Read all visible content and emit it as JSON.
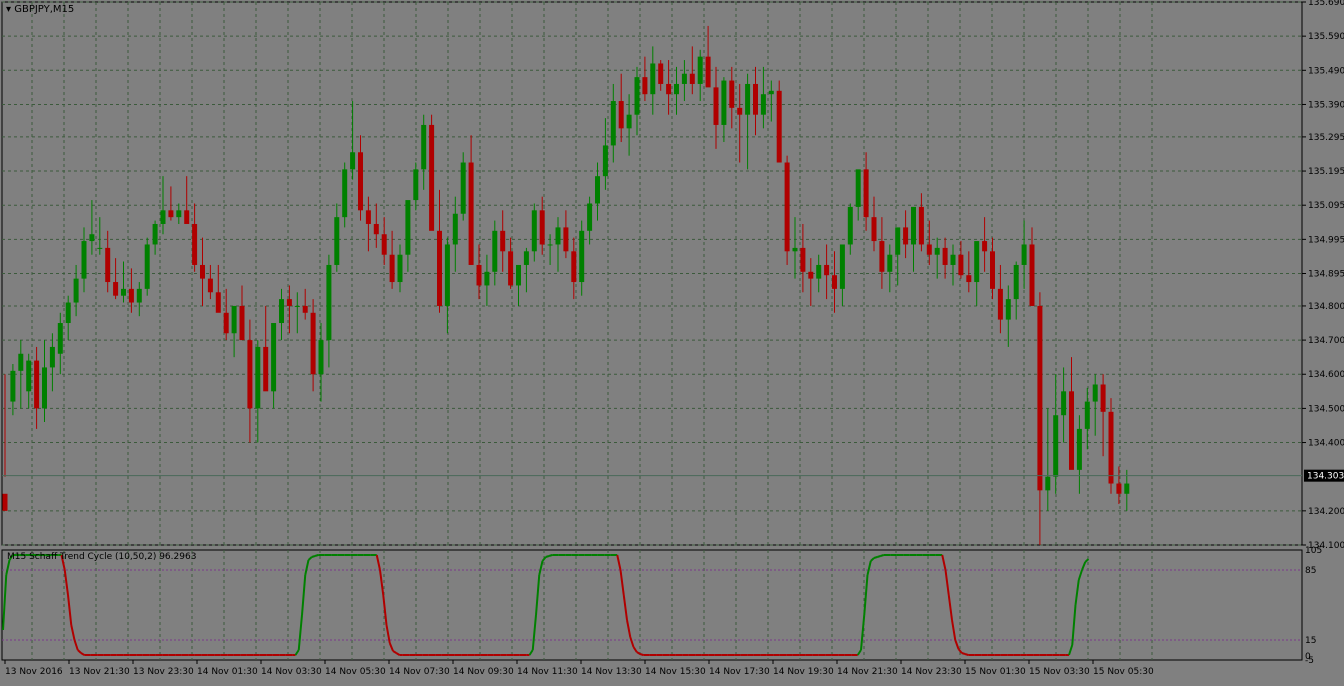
{
  "chart": {
    "symbol_label": "GBPJPY,M15",
    "indicator_label": "M15 Schaff Trend Cycle (10,50,2) 96.2963",
    "current_price": "134.303",
    "price_ticks": [
      "135.690",
      "135.590",
      "135.490",
      "135.390",
      "135.295",
      "135.195",
      "135.095",
      "134.995",
      "134.895",
      "134.800",
      "134.700",
      "134.600",
      "134.500",
      "134.400",
      "134.200",
      "134.100"
    ],
    "indicator_ticks": [
      "105",
      "85",
      "15",
      "-5",
      "0"
    ],
    "time_ticks": [
      "13 Nov 2016",
      "13 Nov 21:30",
      "13 Nov 23:30",
      "14 Nov 01:30",
      "14 Nov 03:30",
      "14 Nov 05:30",
      "14 Nov 07:30",
      "14 Nov 09:30",
      "14 Nov 11:30",
      "14 Nov 13:30",
      "14 Nov 15:30",
      "14 Nov 17:30",
      "14 Nov 19:30",
      "14 Nov 21:30",
      "14 Nov 23:30",
      "15 Nov 01:30",
      "15 Nov 03:30",
      "15 Nov 05:30"
    ],
    "colors": {
      "background": "#808080",
      "bull": "#008000",
      "bear": "#b00000",
      "grid": "#3c5a3c",
      "level": "#7a3a8a"
    }
  },
  "chart_data": [
    {
      "type": "candlestick",
      "title": "GBPJPY,M15",
      "ylim": [
        134.1,
        135.69
      ],
      "current_price": 134.303,
      "candles": [
        [
          134.25,
          134.6,
          134.3,
          134.2
        ],
        [
          134.52,
          134.63,
          134.48,
          134.61
        ],
        [
          134.61,
          134.7,
          134.5,
          134.66
        ],
        [
          134.55,
          134.66,
          134.5,
          134.64
        ],
        [
          134.64,
          134.68,
          134.44,
          134.5
        ],
        [
          134.5,
          134.7,
          134.46,
          134.62
        ],
        [
          134.62,
          134.72,
          134.55,
          134.68
        ],
        [
          134.66,
          134.78,
          134.6,
          134.75
        ],
        [
          134.75,
          134.83,
          134.7,
          134.81
        ],
        [
          134.81,
          134.92,
          134.77,
          134.88
        ],
        [
          134.88,
          135.03,
          134.84,
          134.99
        ],
        [
          134.99,
          135.11,
          134.95,
          135.01
        ],
        [
          134.97,
          135.06,
          134.95,
          134.97
        ],
        [
          134.97,
          135.02,
          134.84,
          134.87
        ],
        [
          134.87,
          134.94,
          134.82,
          134.83
        ],
        [
          134.83,
          134.93,
          134.81,
          134.85
        ],
        [
          134.85,
          134.91,
          134.78,
          134.81
        ],
        [
          134.81,
          134.87,
          134.77,
          134.85
        ],
        [
          134.85,
          135.0,
          134.83,
          134.98
        ],
        [
          134.98,
          135.05,
          134.95,
          135.04
        ],
        [
          135.04,
          135.18,
          135.01,
          135.08
        ],
        [
          135.08,
          135.15,
          135.05,
          135.06
        ],
        [
          135.06,
          135.1,
          135.04,
          135.08
        ],
        [
          135.08,
          135.18,
          135.06,
          135.04
        ],
        [
          135.04,
          135.1,
          134.9,
          134.92
        ],
        [
          134.92,
          135.0,
          134.8,
          134.88
        ],
        [
          134.88,
          134.92,
          134.82,
          134.84
        ],
        [
          134.84,
          134.92,
          134.79,
          134.78
        ],
        [
          134.78,
          134.85,
          134.7,
          134.72
        ],
        [
          134.72,
          134.8,
          134.65,
          134.8
        ],
        [
          134.8,
          134.86,
          134.72,
          134.7
        ],
        [
          134.7,
          134.76,
          134.4,
          134.5
        ],
        [
          134.5,
          134.7,
          134.4,
          134.68
        ],
        [
          134.68,
          134.8,
          134.6,
          134.55
        ],
        [
          134.55,
          134.7,
          134.5,
          134.75
        ],
        [
          134.75,
          134.85,
          134.7,
          134.82
        ],
        [
          134.82,
          134.86,
          134.72,
          134.8
        ],
        [
          134.8,
          134.84,
          134.72,
          134.8
        ],
        [
          134.8,
          134.85,
          134.76,
          134.78
        ],
        [
          134.78,
          134.82,
          134.55,
          134.6
        ],
        [
          134.6,
          134.75,
          134.52,
          134.7
        ],
        [
          134.7,
          134.95,
          134.62,
          134.92
        ],
        [
          134.92,
          135.1,
          134.9,
          135.06
        ],
        [
          135.06,
          135.22,
          135.03,
          135.2
        ],
        [
          135.2,
          135.4,
          135.17,
          135.25
        ],
        [
          135.25,
          135.3,
          135.05,
          135.08
        ],
        [
          135.08,
          135.12,
          134.96,
          135.04
        ],
        [
          135.04,
          135.1,
          134.97,
          135.01
        ],
        [
          135.01,
          135.06,
          134.92,
          134.95
        ],
        [
          134.95,
          135.02,
          134.85,
          134.87
        ],
        [
          134.87,
          134.98,
          134.84,
          134.95
        ],
        [
          134.95,
          135.1,
          134.9,
          135.11
        ],
        [
          135.11,
          135.22,
          135.08,
          135.2
        ],
        [
          135.2,
          135.36,
          135.14,
          135.33
        ],
        [
          135.33,
          135.36,
          135.05,
          135.02
        ],
        [
          135.02,
          135.14,
          134.78,
          134.8
        ],
        [
          134.8,
          135.0,
          134.72,
          134.98
        ],
        [
          134.98,
          135.12,
          134.9,
          135.07
        ],
        [
          135.07,
          135.25,
          135.05,
          135.22
        ],
        [
          135.22,
          135.3,
          134.92,
          134.92
        ],
        [
          134.92,
          134.98,
          134.82,
          134.86
        ],
        [
          134.86,
          134.95,
          134.8,
          134.9
        ],
        [
          134.9,
          135.05,
          134.86,
          135.02
        ],
        [
          135.02,
          135.08,
          134.9,
          134.96
        ],
        [
          134.96,
          135.0,
          134.85,
          134.86
        ],
        [
          134.86,
          134.92,
          134.8,
          134.92
        ],
        [
          134.92,
          134.97,
          134.84,
          134.96
        ],
        [
          134.96,
          135.1,
          134.93,
          135.08
        ],
        [
          135.08,
          135.12,
          134.95,
          134.98
        ],
        [
          134.98,
          135.01,
          134.92,
          134.98
        ],
        [
          134.98,
          135.06,
          134.9,
          135.03
        ],
        [
          135.03,
          135.08,
          134.94,
          134.96
        ],
        [
          134.96,
          135.0,
          134.82,
          134.87
        ],
        [
          134.87,
          135.05,
          134.83,
          135.02
        ],
        [
          135.02,
          135.12,
          134.98,
          135.1
        ],
        [
          135.1,
          135.22,
          135.05,
          135.18
        ],
        [
          135.18,
          135.35,
          135.14,
          135.27
        ],
        [
          135.27,
          135.45,
          135.22,
          135.4
        ],
        [
          135.4,
          135.48,
          135.28,
          135.32
        ],
        [
          135.32,
          135.42,
          135.24,
          135.36
        ],
        [
          135.36,
          135.5,
          135.3,
          135.47
        ],
        [
          135.47,
          135.53,
          135.4,
          135.42
        ],
        [
          135.42,
          135.56,
          135.36,
          135.51
        ],
        [
          135.51,
          135.52,
          135.43,
          135.45
        ],
        [
          135.45,
          135.52,
          135.36,
          135.42
        ],
        [
          135.42,
          135.5,
          135.36,
          135.45
        ],
        [
          135.45,
          135.52,
          135.4,
          135.48
        ],
        [
          135.48,
          135.56,
          135.42,
          135.45
        ],
        [
          135.45,
          135.55,
          135.4,
          135.53
        ],
        [
          135.53,
          135.62,
          135.45,
          135.44
        ],
        [
          135.44,
          135.5,
          135.26,
          135.33
        ],
        [
          135.33,
          135.47,
          135.28,
          135.46
        ],
        [
          135.46,
          135.5,
          135.32,
          135.38
        ],
        [
          135.38,
          135.45,
          135.22,
          135.36
        ],
        [
          135.36,
          135.48,
          135.2,
          135.45
        ],
        [
          135.45,
          135.5,
          135.3,
          135.36
        ],
        [
          135.36,
          135.5,
          135.32,
          135.42
        ],
        [
          135.42,
          135.46,
          135.34,
          135.43
        ],
        [
          135.43,
          135.46,
          135.28,
          135.22
        ],
        [
          135.22,
          135.24,
          134.92,
          134.96
        ],
        [
          134.96,
          135.06,
          134.88,
          134.97
        ],
        [
          134.97,
          135.04,
          134.84,
          134.9
        ],
        [
          134.9,
          134.94,
          134.8,
          134.88
        ],
        [
          134.88,
          134.95,
          134.84,
          134.92
        ],
        [
          134.92,
          134.98,
          134.82,
          134.89
        ],
        [
          134.89,
          134.96,
          134.78,
          134.85
        ],
        [
          134.85,
          134.94,
          134.8,
          134.98
        ],
        [
          134.98,
          135.1,
          134.95,
          135.09
        ],
        [
          135.09,
          135.18,
          135.05,
          135.2
        ],
        [
          135.2,
          135.25,
          135.02,
          135.06
        ],
        [
          135.06,
          135.12,
          134.96,
          134.99
        ],
        [
          134.99,
          135.06,
          134.85,
          134.9
        ],
        [
          134.9,
          134.98,
          134.84,
          134.95
        ],
        [
          134.95,
          135.02,
          134.86,
          135.03
        ],
        [
          135.03,
          135.08,
          134.94,
          134.98
        ],
        [
          134.98,
          135.04,
          134.9,
          135.09
        ],
        [
          135.09,
          135.13,
          134.96,
          134.98
        ],
        [
          134.98,
          135.05,
          134.92,
          134.95
        ],
        [
          134.95,
          135.0,
          134.88,
          134.97
        ],
        [
          134.97,
          135.0,
          134.88,
          134.92
        ],
        [
          134.92,
          134.98,
          134.86,
          134.95
        ],
        [
          134.95,
          134.99,
          134.88,
          134.89
        ],
        [
          134.89,
          134.96,
          134.84,
          134.87
        ],
        [
          134.87,
          134.95,
          134.8,
          134.99
        ],
        [
          134.99,
          135.06,
          134.9,
          134.96
        ],
        [
          134.96,
          135.0,
          134.82,
          134.85
        ],
        [
          134.85,
          134.92,
          134.72,
          134.76
        ],
        [
          134.76,
          134.86,
          134.68,
          134.82
        ],
        [
          134.82,
          134.93,
          134.76,
          134.92
        ],
        [
          134.92,
          135.05,
          134.85,
          134.98
        ],
        [
          134.98,
          135.03,
          134.8,
          134.8
        ],
        [
          134.8,
          134.84,
          134.1,
          134.26
        ],
        [
          134.26,
          134.5,
          134.2,
          134.3
        ],
        [
          134.3,
          134.6,
          134.25,
          134.48
        ],
        [
          134.48,
          134.62,
          134.4,
          134.55
        ],
        [
          134.55,
          134.65,
          134.36,
          134.32
        ],
        [
          134.32,
          134.48,
          134.25,
          134.44
        ],
        [
          134.44,
          134.56,
          134.38,
          134.52
        ],
        [
          134.52,
          134.6,
          134.42,
          134.57
        ],
        [
          134.57,
          134.6,
          134.36,
          134.49
        ],
        [
          134.49,
          134.53,
          134.25,
          134.28
        ],
        [
          134.28,
          134.33,
          134.22,
          134.25
        ],
        [
          134.25,
          134.32,
          134.2,
          134.28
        ]
      ]
    },
    {
      "type": "line",
      "title": "M15 Schaff Trend Cycle (10,50,2) 96.2963",
      "ylim": [
        -5,
        105
      ],
      "levels": [
        85,
        15
      ],
      "values": [
        25,
        80,
        95,
        100,
        100,
        100,
        100,
        100,
        100,
        100,
        100,
        100,
        100,
        100,
        100,
        100,
        100,
        100,
        100,
        85,
        60,
        30,
        15,
        5,
        2,
        0,
        0,
        0,
        0,
        0,
        0,
        0,
        0,
        0,
        0,
        0,
        0,
        0,
        0,
        0,
        0,
        0,
        0,
        0,
        0,
        0,
        0,
        0,
        0,
        0,
        0,
        0,
        0,
        0,
        0,
        0,
        0,
        0,
        0,
        0,
        0,
        0,
        0,
        0,
        0,
        0,
        0,
        0,
        0,
        0,
        0,
        0,
        0,
        0,
        0,
        0,
        0,
        0,
        0,
        0,
        0,
        0,
        0,
        0,
        0,
        0,
        0,
        0,
        0,
        0,
        0,
        5,
        40,
        80,
        95,
        98,
        99,
        100,
        100,
        100,
        100,
        100,
        100,
        100,
        100,
        100,
        100,
        100,
        100,
        100,
        100,
        100,
        100,
        100,
        100,
        100,
        85,
        60,
        30,
        12,
        4,
        2,
        0,
        0,
        0,
        0,
        0,
        0,
        0,
        0,
        0,
        0,
        0,
        0,
        0,
        0,
        0,
        0,
        0,
        0,
        0,
        0,
        0,
        0,
        0,
        0,
        0,
        0,
        0,
        0,
        0,
        0,
        0,
        0,
        0,
        0,
        0,
        0,
        0,
        0,
        0,
        0,
        0,
        5,
        40,
        80,
        94,
        98,
        99,
        100,
        100,
        100,
        100,
        100,
        100,
        100,
        100,
        100,
        100,
        100,
        100,
        100,
        100,
        100,
        100,
        100,
        100,
        100,
        100,
        100,
        85,
        60,
        35,
        18,
        8,
        3,
        1,
        0,
        0,
        0,
        0,
        0,
        0,
        0,
        0,
        0,
        0,
        0,
        0,
        0,
        0,
        0,
        0,
        0,
        0,
        0,
        0,
        0,
        0,
        0,
        0,
        0,
        0,
        0,
        0,
        0,
        0,
        0,
        0,
        0,
        0,
        0,
        0,
        0,
        0,
        0,
        0,
        0,
        0,
        0,
        0,
        0,
        0,
        0,
        0,
        0,
        0,
        0,
        0,
        0,
        0,
        0,
        0,
        0,
        0,
        0,
        0,
        0,
        0,
        0,
        0,
        0,
        0,
        0,
        5,
        40,
        80,
        94,
        97,
        98,
        99,
        100,
        100,
        100,
        100,
        100,
        100,
        100,
        100,
        100,
        100,
        100,
        100,
        100,
        100,
        100,
        100,
        100,
        100,
        100,
        85,
        60,
        35,
        15,
        6,
        2,
        1,
        0,
        0,
        0,
        0,
        0,
        0,
        0,
        0,
        0,
        0,
        0,
        0,
        0,
        0,
        0,
        0,
        0,
        0,
        0,
        0,
        0,
        0,
        0,
        0,
        0,
        0,
        0,
        0,
        0,
        0,
        0,
        0,
        10,
        50,
        75,
        85,
        93,
        96
      ]
    }
  ]
}
